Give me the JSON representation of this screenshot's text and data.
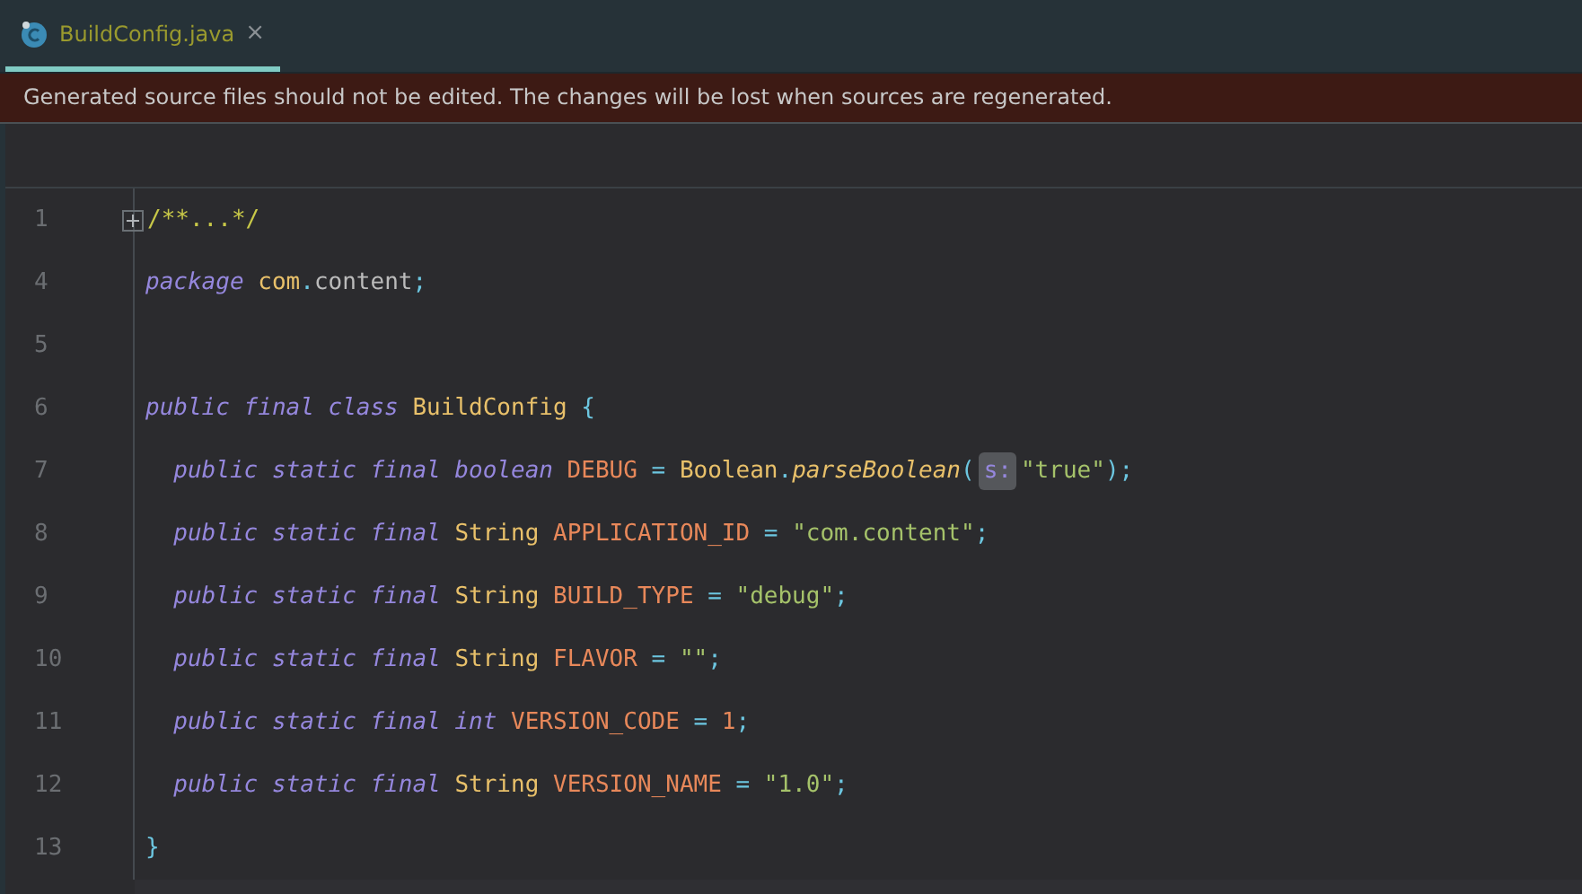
{
  "tabs": [
    {
      "label": "BuildConfig.java",
      "close": "×",
      "selected": true
    }
  ],
  "banner": "Generated source files should not be edited. The changes will be lost when sources are regenerated.",
  "lines": [
    {
      "number": "1",
      "folded": true,
      "tokens": [
        {
          "kind": "comment",
          "text": "/**...*/"
        }
      ]
    },
    {
      "number": "4",
      "tokens": [
        {
          "kind": "keyword",
          "text": "package "
        },
        {
          "kind": "type",
          "text": "com"
        },
        {
          "kind": "punct",
          "text": "."
        },
        {
          "kind": "plain",
          "text": "content"
        },
        {
          "kind": "punct",
          "text": ";"
        }
      ]
    },
    {
      "number": "5"
    },
    {
      "number": "6",
      "tokens": [
        {
          "kind": "keyword",
          "text": "public final class "
        },
        {
          "kind": "type",
          "text": "BuildConfig"
        },
        {
          "kind": "punct",
          "text": " {"
        }
      ]
    },
    {
      "number": "7",
      "tokens": [
        {
          "kind": "keyword",
          "text": "  public static final boolean"
        },
        {
          "kind": "field",
          "text": " DEBUG"
        },
        {
          "kind": "punct",
          "text": " = "
        },
        {
          "kind": "type",
          "text": "Boolean"
        },
        {
          "kind": "punct",
          "text": "."
        },
        {
          "kind": "method",
          "text": "parseBoolean"
        },
        {
          "kind": "punct",
          "text": "("
        },
        {
          "kind": "hint",
          "text": "s:"
        },
        {
          "kind": "string",
          "text": "\"true\""
        },
        {
          "kind": "punct",
          "text": ");"
        }
      ]
    },
    {
      "number": "8",
      "tokens": [
        {
          "kind": "keyword",
          "text": "  public static final"
        },
        {
          "kind": "type",
          "text": " String"
        },
        {
          "kind": "field",
          "text": " APPLICATION_ID"
        },
        {
          "kind": "punct",
          "text": " = "
        },
        {
          "kind": "string",
          "text": "\"com.content\""
        },
        {
          "kind": "punct",
          "text": ";"
        }
      ]
    },
    {
      "number": "9",
      "tokens": [
        {
          "kind": "keyword",
          "text": "  public static final"
        },
        {
          "kind": "type",
          "text": " String"
        },
        {
          "kind": "field",
          "text": " BUILD_TYPE"
        },
        {
          "kind": "punct",
          "text": " = "
        },
        {
          "kind": "string",
          "text": "\"debug\""
        },
        {
          "kind": "punct",
          "text": ";"
        }
      ]
    },
    {
      "number": "10",
      "tokens": [
        {
          "kind": "keyword",
          "text": "  public static final"
        },
        {
          "kind": "type",
          "text": " String"
        },
        {
          "kind": "field",
          "text": " FLAVOR"
        },
        {
          "kind": "punct",
          "text": " = "
        },
        {
          "kind": "string",
          "text": "\"\""
        },
        {
          "kind": "punct",
          "text": ";"
        }
      ]
    },
    {
      "number": "11",
      "tokens": [
        {
          "kind": "keyword",
          "text": "  public static final int"
        },
        {
          "kind": "field",
          "text": " VERSION_CODE"
        },
        {
          "kind": "punct",
          "text": " = "
        },
        {
          "kind": "number",
          "text": "1"
        },
        {
          "kind": "punct",
          "text": ";"
        }
      ]
    },
    {
      "number": "12",
      "tokens": [
        {
          "kind": "keyword",
          "text": "  public static final"
        },
        {
          "kind": "type",
          "text": " String"
        },
        {
          "kind": "field",
          "text": " VERSION_NAME"
        },
        {
          "kind": "punct",
          "text": " = "
        },
        {
          "kind": "string",
          "text": "\"1.0\""
        },
        {
          "kind": "punct",
          "text": ";"
        }
      ]
    },
    {
      "number": "13",
      "tokens": [
        {
          "kind": "punct",
          "text": "}"
        }
      ]
    }
  ]
}
